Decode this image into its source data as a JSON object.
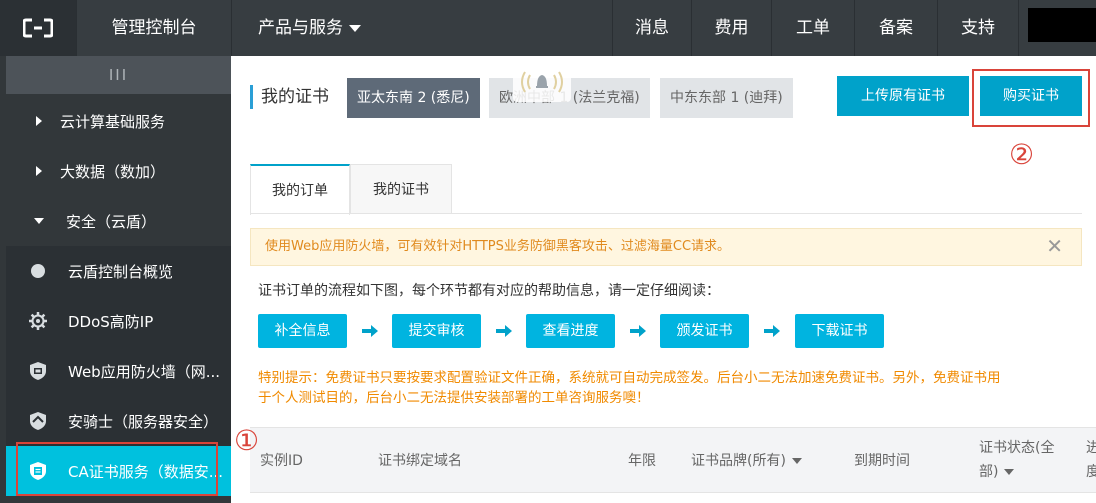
{
  "topbar": {
    "logo_icon": "aliyun-logo-icon",
    "console_title": "管理控制台",
    "products_label": "产品与服务",
    "nav": [
      "消息",
      "费用",
      "工单",
      "备案",
      "支持"
    ]
  },
  "sidebar": {
    "toggle_label": "III",
    "groups": [
      {
        "label": "云计算基础服务",
        "expanded": false
      },
      {
        "label": "大数据（数加）",
        "expanded": false
      },
      {
        "label": "安全（云盾）",
        "expanded": true
      }
    ],
    "sub_items": [
      {
        "label": "云盾控制台概览",
        "icon": "dot-icon"
      },
      {
        "label": "DDoS高防IP",
        "icon": "gear-icon"
      },
      {
        "label": "Web应用防火墙（网...",
        "icon": "shield-icon"
      },
      {
        "label": "安骑士（服务器安全）",
        "icon": "shield-icon"
      },
      {
        "label": "CA证书服务（数据安...",
        "icon": "certificate-icon",
        "active": true
      }
    ]
  },
  "main": {
    "title": "我的证书",
    "regions": [
      "亚太东南 2 (悉尼)",
      "欧洲中部 1 (法兰克福)",
      "中东东部 1 (迪拜)"
    ],
    "upload_button": "上传原有证书",
    "buy_button": "购买证书",
    "tabs": [
      "我的订单",
      "我的证书"
    ],
    "notice": "使用Web应用防火墙，可有效针对HTTPS业务防御黑客攻击、过滤海量CC请求。",
    "notice_close": "✕",
    "flow_intro": "证书订单的流程如下图，每个环节都有对应的帮助信息，请一定仔细阅读：",
    "steps": [
      "补全信息",
      "提交审核",
      "查看进度",
      "颁发证书",
      "下载证书"
    ],
    "tip_line1": "特别提示：免费证书只要按要求配置验证文件正确，系统就可自动完成签发。后台小二无法加速免费证书。另外，免费证书用",
    "tip_line2": "于个人测试目的，后台小二无法提供安装部署的工单咨询服务噢！",
    "table_headers": {
      "instance_id": "实例ID",
      "domain": "证书绑定域名",
      "years": "年限",
      "brand": "证书品牌(所有)",
      "expiry": "到期时间",
      "status_line1": "证书状态(全",
      "status_line2": "部)",
      "extra_line1": "进",
      "extra_line2": "度"
    }
  },
  "annotations": {
    "marker1": "①",
    "marker2": "②"
  },
  "colors": {
    "topbar": "#373d41",
    "sidebar": "#32373a",
    "active_item": "#00c1de",
    "primary_button": "#00a2ca",
    "highlight_red": "#d9443a",
    "tip_orange": "#f08a00"
  }
}
